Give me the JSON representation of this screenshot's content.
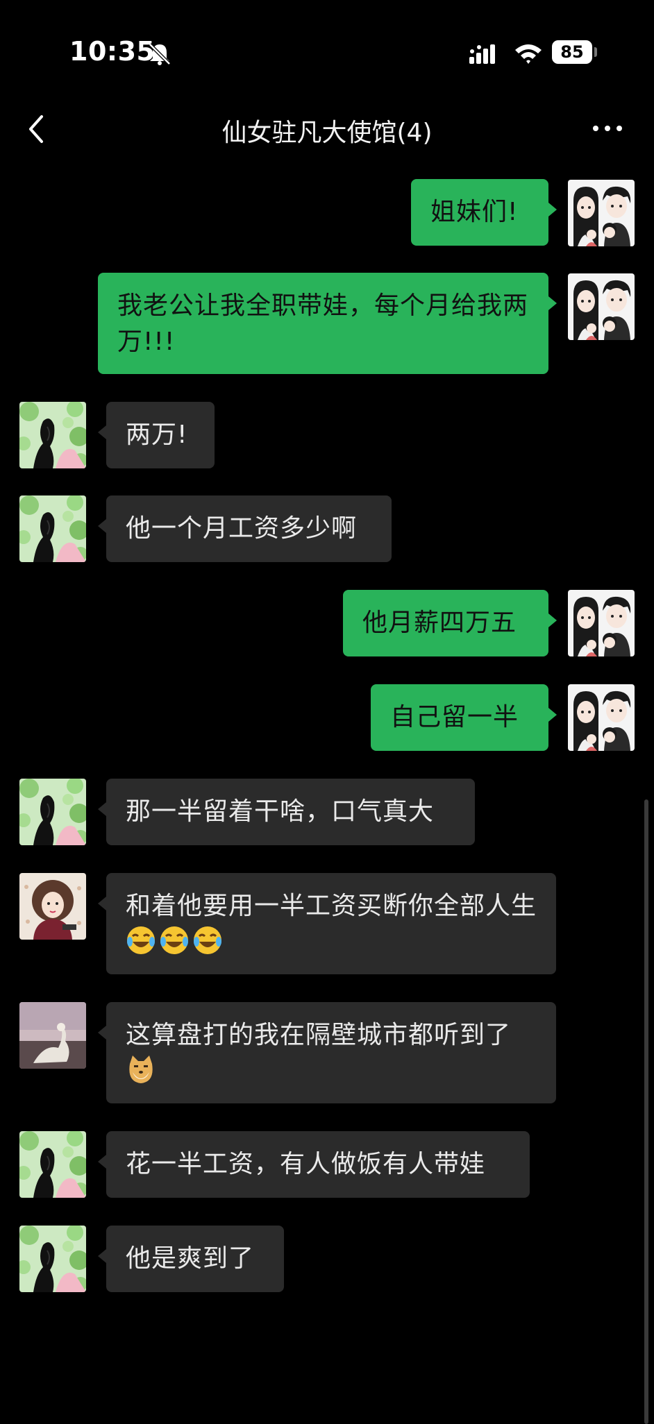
{
  "status_bar": {
    "time": "10:35",
    "battery": "85",
    "icons": [
      "bell-slash-icon",
      "signal-icon",
      "wifi-icon",
      "battery-icon"
    ]
  },
  "nav": {
    "title": "仙女驻凡大使馆(4)",
    "back_icon": "chevron-left-icon",
    "more_icon": "more-dots-icon"
  },
  "colors": {
    "background": "#000000",
    "my_bubble": "#29b35a",
    "their_bubble": "#2b2b2b"
  },
  "messages": [
    {
      "side": "mine",
      "text": "姐妹们!"
    },
    {
      "side": "mine",
      "text": "我老公让我全职带娃，每个月给我两万!!!"
    },
    {
      "side": "theirs",
      "text": "两万!"
    },
    {
      "side": "theirs",
      "text": "他一个月工资多少啊"
    },
    {
      "side": "mine",
      "text": "他月薪四万五"
    },
    {
      "side": "mine",
      "text": "自己留一半"
    },
    {
      "side": "theirs",
      "text": "那一半留着干啥，口气真大"
    },
    {
      "side": "theirs",
      "text": "和着他要用一半工资买断你全部人生",
      "emojis": [
        "laugh-cry-emoji",
        "laugh-cry-emoji",
        "laugh-cry-emoji"
      ]
    },
    {
      "side": "theirs",
      "text": "这算盘打的我在隔壁城市都听到了",
      "emojis": [
        "doge-emoji"
      ]
    },
    {
      "side": "theirs",
      "text": "花一半工资，有人做饭有人带娃"
    },
    {
      "side": "theirs",
      "text": "他是爽到了"
    }
  ]
}
